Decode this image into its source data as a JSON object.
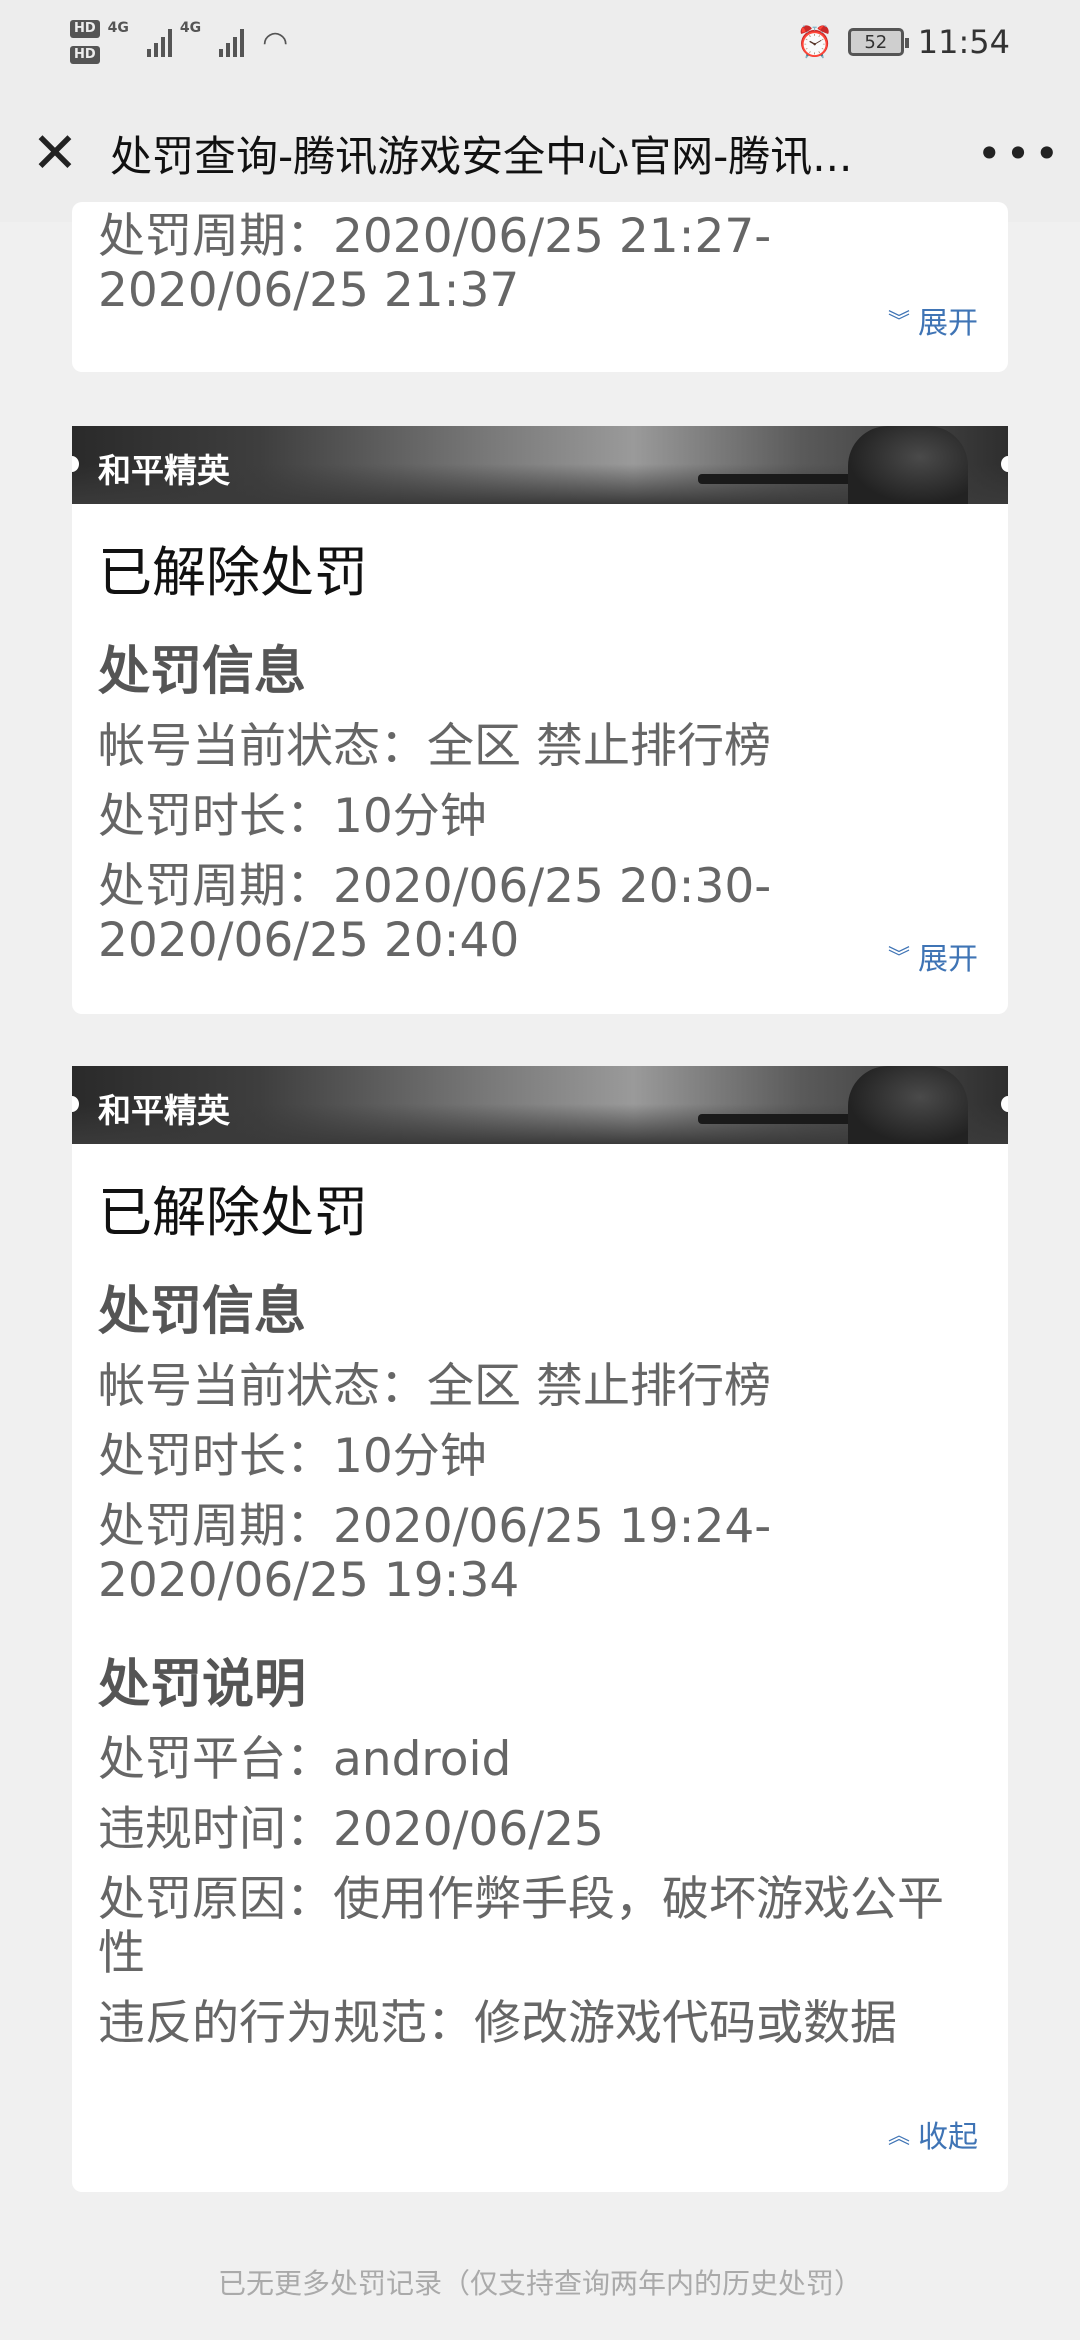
{
  "status_bar": {
    "hd1": "HD",
    "hd2": "HD",
    "net1": "4G",
    "net2": "4G",
    "battery": "52",
    "time": "11:54"
  },
  "topbar": {
    "close_glyph": "✕",
    "title": "处罚查询-腾讯游戏安全中心官网-腾讯...",
    "more_glyph": "•••"
  },
  "card0": {
    "period_label": "处罚周期：",
    "period_value": "2020/06/25 21:27-2020/06/25 21:37",
    "toggle_label": "展开"
  },
  "card1": {
    "game": "和平精英",
    "status": "已解除处罚",
    "section_info": "处罚信息",
    "state_label": "帐号当前状态：",
    "state_value": "全区 禁止排行榜",
    "duration_label": "处罚时长：",
    "duration_value": "10分钟",
    "period_label": "处罚周期：",
    "period_value": "2020/06/25 20:30-2020/06/25 20:40",
    "toggle_label": "展开"
  },
  "card2": {
    "game": "和平精英",
    "status": "已解除处罚",
    "section_info": "处罚信息",
    "state_label": "帐号当前状态：",
    "state_value": "全区 禁止排行榜",
    "duration_label": "处罚时长：",
    "duration_value": "10分钟",
    "period_label": "处罚周期：",
    "period_value": "2020/06/25 19:24-2020/06/25 19:34",
    "section_desc": "处罚说明",
    "platform_label": "处罚平台：",
    "platform_value": "android",
    "violation_time_label": "违规时间：",
    "violation_time_value": "2020/06/25",
    "reason_label": "处罚原因：",
    "reason_value": "使用作弊手段，破坏游戏公平性",
    "rule_label": "违反的行为规范：",
    "rule_value": "修改游戏代码或数据",
    "toggle_label": "收起"
  },
  "footer": "已无更多处罚记录（仅支持查询两年内的历史处罚）"
}
